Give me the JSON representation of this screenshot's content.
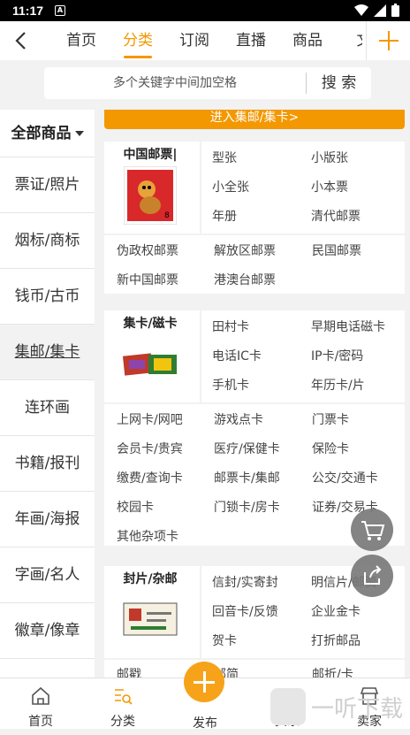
{
  "status_bar": {
    "time": "11:17",
    "notification": "A"
  },
  "nav": {
    "back": "back",
    "tabs": [
      "首页",
      "分类",
      "订阅",
      "直播",
      "商品",
      "文"
    ],
    "active_tab": "分类"
  },
  "search": {
    "placeholder": "多个关键字中间加空格",
    "button": "搜 索"
  },
  "sidebar": {
    "all_label": "全部商品",
    "items": [
      "票证/照片",
      "烟标/商标",
      "钱币/古币",
      "集邮/集卡",
      "连环画",
      "书籍/报刊",
      "年画/海报",
      "字画/名人",
      "徽章/像章"
    ],
    "active": "集邮/集卡"
  },
  "banner": "进入集邮/集卡>",
  "cards": [
    {
      "title": "中国邮票|",
      "right": [
        "型张",
        "小版张",
        "小全张",
        "小本票",
        "年册",
        "清代邮票"
      ],
      "bottom": [
        "伪政权邮票",
        "解放区邮票",
        "民国邮票",
        "新中国邮票",
        "港澳台邮票"
      ]
    },
    {
      "title": "集卡/磁卡",
      "right": [
        "田村卡",
        "早期电话磁卡",
        "电话IC卡",
        "IP卡/密码",
        "手机卡",
        "年历卡/片"
      ],
      "bottom": [
        "上网卡/网吧",
        "游戏点卡",
        "门票卡",
        "会员卡/贵宾",
        "医疗/保健卡",
        "保险卡",
        "缴费/查询卡",
        "邮票卡/集邮",
        "公交/交通卡",
        "校园卡",
        "门锁卡/房卡",
        "证券/交易卡",
        "其他杂项卡"
      ]
    },
    {
      "title": "封片/杂邮",
      "right": [
        "信封/实寄封",
        "明信片/邮资",
        "回音卡/反馈",
        "企业金卡",
        "贺卡",
        "打折邮品"
      ],
      "bottom": [
        "邮戳",
        "邮简",
        "邮折/卡"
      ]
    }
  ],
  "bottom_nav": [
    "首页",
    "分类",
    "发布",
    "买家",
    "卖家"
  ],
  "watermark": "一听下载",
  "colors": {
    "accent": "#f39800",
    "publish": "#f6a31a"
  }
}
